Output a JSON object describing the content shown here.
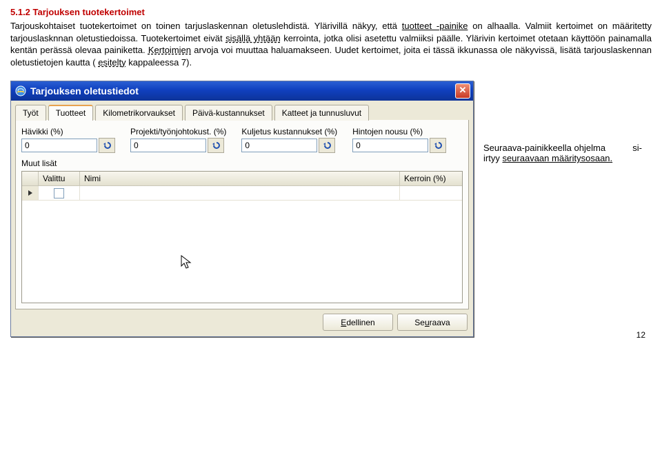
{
  "heading": "5.1.2 Tarjouksen tuotekertoimet",
  "para_start": "Tarjouskohtaiset tuotekertoimet on toinen tarjuslaskennan oletuslehdistä. Ylärivillä näkyy, että ",
  "para_link": "tuotteet -painike",
  "para_mid": " on alhaalla. Valmiit kertoimet on määritetty tarjouslasknnan oletustiedoissa. Tuotekertoimet eivät ",
  "para_dash1": "sisällä yhtään",
  "para_mid2": " kerrointa, jotka olisi asetettu valmiiksi päälle. Ylärivin kertoimet otetaan käyttöön painamalla kentän perässä olevaa painiketta. ",
  "para_dash2": "Kertoimien",
  "para_mid3": " arvoja voi muuttaa haluamakseen. Uudet kertoimet, joita ei tässä ikkunassa ole näkyvissä, lisätä tarjouslaskennan oletustietojen kautta (",
  "para_dash3": "esitelty",
  "para_end": " kappaleessa 7).",
  "window": {
    "title": "Tarjouksen oletustiedot",
    "tabs": [
      "Työt",
      "Tuotteet",
      "Kilometrikorvaukset",
      "Päivä-kustannukset",
      "Katteet ja tunnusluvut"
    ],
    "fields": {
      "havikki_label": "Hävikki (%)",
      "havikki_value": "0",
      "projekti_label": "Projekti/työnjohtokust. (%)",
      "projekti_value": "0",
      "kuljetus_label": "Kuljetus kustannukset (%)",
      "kuljetus_value": "0",
      "hintojen_label": "Hintojen nousu (%)",
      "hintojen_value": "0"
    },
    "sub_label": "Muut lisät",
    "grid_headers": {
      "c1": "Valittu",
      "c2": "Nimi",
      "c3": "Kerroin (%)"
    },
    "buttons": {
      "prev_pre": "",
      "prev_mn": "E",
      "prev_post": "dellinen",
      "next_pre": "Se",
      "next_mn": "u",
      "next_post": "raava"
    }
  },
  "sidenote": {
    "l1a": "Seuraava-painikkeella ohjelma",
    "l1b": "si-",
    "l2": "irtyy ",
    "link": "seuraavaan määritysosaan.",
    "l3": ""
  },
  "page": "12"
}
